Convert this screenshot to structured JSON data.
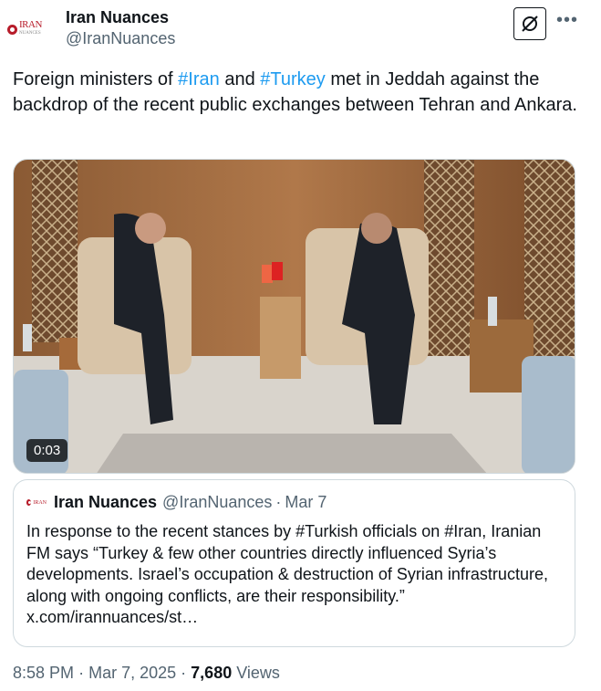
{
  "author": {
    "logo_text": "IRAN",
    "logo_sub": "NUANCES",
    "display_name": "Iran Nuances",
    "handle": "@IranNuances"
  },
  "tweet": {
    "text_before": "Foreign ministers of ",
    "hashtag1": "#Iran",
    "text_mid": " and ",
    "hashtag2": "#Turkey",
    "text_after": " met in Jeddah against the backdrop of the recent public exchanges between Tehran and Ankara."
  },
  "media": {
    "duration": "0:03"
  },
  "quote": {
    "display_name": "Iran Nuances",
    "handle": "@IranNuances",
    "separator": "·",
    "date": "Mar 7",
    "text": "In response to the recent stances by #Turkish officials on #Iran, Iranian FM says “Turkey & few other countries directly influenced Syria’s developments. Israel’s occupation & destruction of Syrian infrastructure, along with ongoing conflicts, are their responsibility.” x.com/irannuances/st…"
  },
  "footer": {
    "time": "8:58 PM",
    "separator": "·",
    "date": "Mar 7, 2025",
    "views_count": "7,680",
    "views_label": "Views"
  },
  "icons": [
    "grok-icon",
    "more-icon"
  ]
}
